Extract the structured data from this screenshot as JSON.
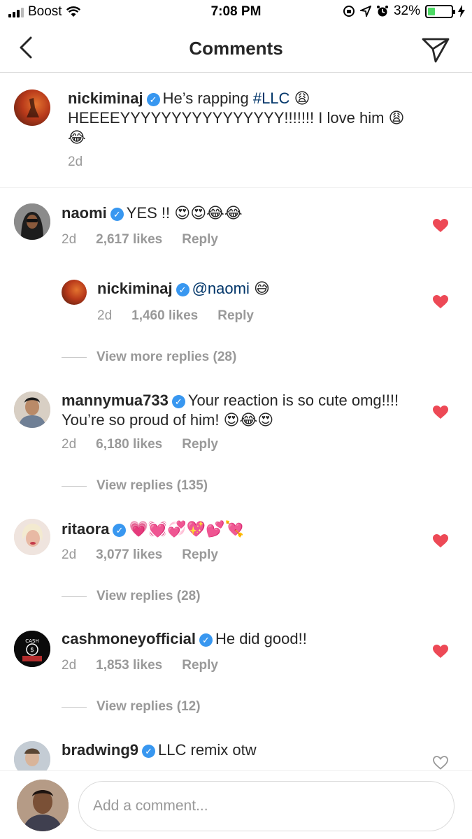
{
  "status_bar": {
    "carrier": "Boost",
    "time": "7:08 PM",
    "battery": "32%",
    "battery_level": 0.32
  },
  "header": {
    "title": "Comments"
  },
  "caption": {
    "username": "nickiminaj",
    "text_before": "He’s rapping ",
    "hashtag": "#LLC",
    "text_after": " 😩 HEEEEYYYYYYYYYYYYYYYY!!!!!!! I love him 😩😂",
    "time": "2d"
  },
  "comments": [
    {
      "username": "naomi",
      "text": "YES !! 😍😍😂😂",
      "time": "2d",
      "likes": "2,617 likes",
      "reply": "Reply",
      "liked": true
    },
    {
      "username": "nickiminaj",
      "mention": "@naomi",
      "text": " 😅",
      "time": "2d",
      "likes": "1,460 likes",
      "reply": "Reply",
      "liked": true
    },
    {
      "view_replies": "View more replies (28)"
    },
    {
      "username": "mannymua733",
      "text": "Your reaction is so cute omg!!!! You’re so proud of him! 😍😂😍",
      "time": "2d",
      "likes": "6,180 likes",
      "reply": "Reply",
      "liked": true,
      "view_replies": "View replies (135)"
    },
    {
      "username": "ritaora",
      "text": "💗💓💞💖💕💘",
      "time": "2d",
      "likes": "3,077 likes",
      "reply": "Reply",
      "liked": true,
      "view_replies": "View replies (28)"
    },
    {
      "username": "cashmoneyofficial",
      "text": "He did good!!",
      "time": "2d",
      "likes": "1,853 likes",
      "reply": "Reply",
      "liked": true,
      "view_replies": "View replies (12)"
    },
    {
      "username": "bradwing9",
      "text": "LLC remix otw",
      "liked": false
    }
  ],
  "input": {
    "placeholder": "Add a comment..."
  },
  "colors": {
    "heart": "#ed4956",
    "verified": "#3897f0",
    "meta": "#999999",
    "link": "#003569"
  }
}
